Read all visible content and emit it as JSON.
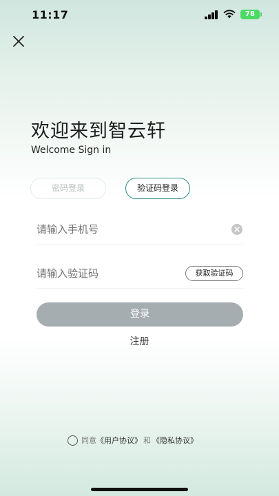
{
  "status_bar": {
    "time": "11:17",
    "battery": "78",
    "icons": [
      "signal-icon",
      "wifi-icon",
      "battery-icon"
    ]
  },
  "header": {
    "close_icon": "close-icon"
  },
  "welcome": {
    "title": "欢迎来到智云轩",
    "subtitle": "Welcome Sign in"
  },
  "login_tabs": [
    {
      "label": "密码登录",
      "active": false
    },
    {
      "label": "验证码登录",
      "active": true
    }
  ],
  "form": {
    "phone": {
      "value": "",
      "placeholder": "请输入手机号"
    },
    "code": {
      "value": "",
      "placeholder": "请输入验证码"
    },
    "get_code_label": "获取验证码",
    "login_label": "登录",
    "register_label": "注册"
  },
  "agreement": {
    "prefix": "同意",
    "user_agreement": "《用户协议》",
    "conjunction": "和",
    "privacy_policy": "《隐私协议》"
  },
  "colors": {
    "accent": "#2f8c8a",
    "login_button": "#a6adb1",
    "battery": "#4cd964"
  }
}
